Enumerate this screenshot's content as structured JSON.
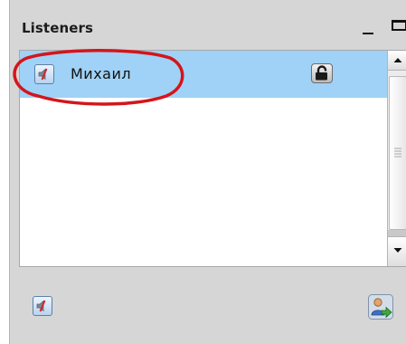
{
  "panel": {
    "title": "Listeners"
  },
  "window_controls": {
    "minimize_icon": "minimize-icon",
    "maximize_icon": "maximize-icon"
  },
  "listeners": [
    {
      "name": "Михаил",
      "selected": true,
      "mute_icon": "speaker-muted-icon",
      "lock_icon": "lock-open-icon"
    }
  ],
  "footer": {
    "mute_all_icon": "speaker-muted-icon",
    "add_user_icon": "user-add-icon"
  },
  "colors": {
    "panel_background": "#d6d6d6",
    "selection": "#9fd2f6",
    "annotation_ellipse": "#d4151c"
  }
}
